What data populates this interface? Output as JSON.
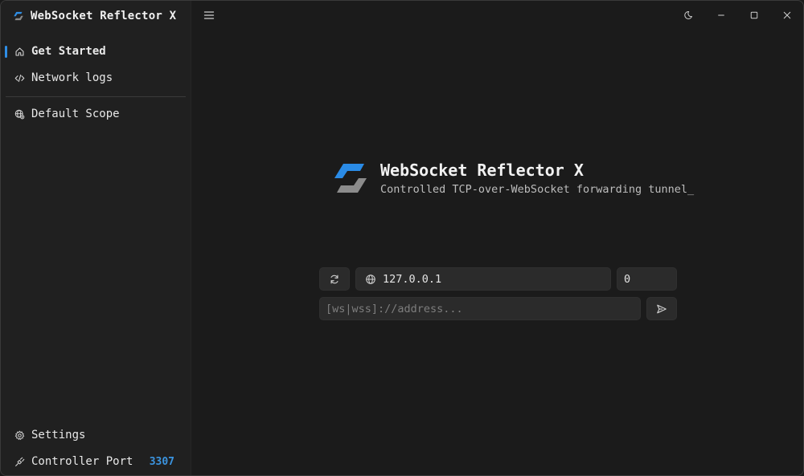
{
  "app": {
    "title": "WebSocket Reflector X",
    "logo_icon": "wsrx-logo-icon"
  },
  "sidebar": {
    "items": [
      {
        "label": "Get Started",
        "icon": "home-icon",
        "active": true
      },
      {
        "label": "Network logs",
        "icon": "code-icon",
        "active": false
      },
      {
        "label": "Default Scope",
        "icon": "globe-scope-icon",
        "active": false
      }
    ],
    "bottom": [
      {
        "label": "Settings",
        "icon": "gear-icon"
      },
      {
        "label": "Controller Port",
        "icon": "plug-icon",
        "value": "3307"
      }
    ]
  },
  "titlebar": {
    "controls": [
      "theme-toggle-icon",
      "minimize-icon",
      "maximize-icon",
      "close-icon"
    ]
  },
  "hero": {
    "title": "WebSocket Reflector X",
    "subtitle": "Controlled TCP-over-WebSocket forwarding tunnel_"
  },
  "form": {
    "host_value": "127.0.0.1",
    "port_value": "0",
    "address_placeholder": "[ws|wss]://address..."
  },
  "colors": {
    "accent": "#2f8ee6",
    "port_value": "#3b94e0",
    "sidebar_bg": "#202020",
    "main_bg": "#1b1b1b",
    "field_bg": "#2b2b2b"
  }
}
